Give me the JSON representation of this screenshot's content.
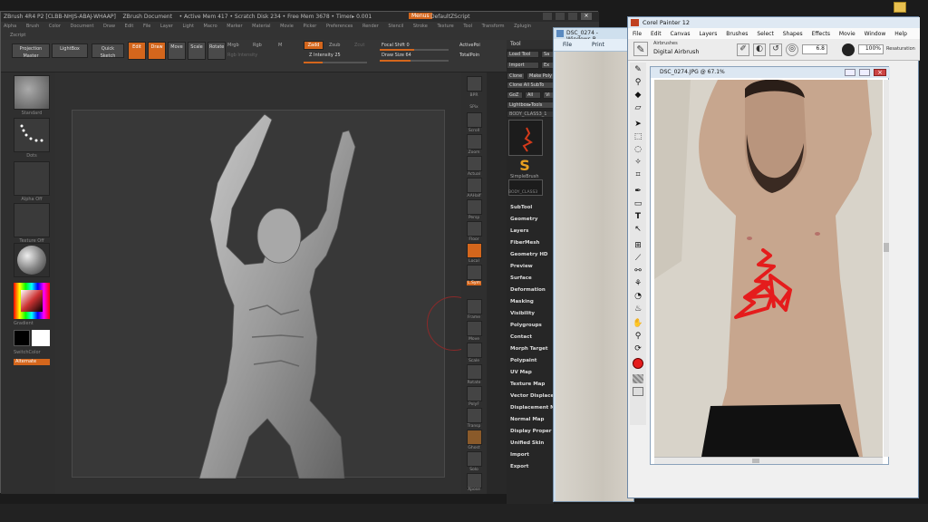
{
  "zbrush": {
    "title_left": "ZBrush 4R4 P2 [CLBB-NHJS-ABAJ-WHAAP]",
    "title_doc": "ZBrush Document",
    "title_status": "• Active Mem 417 • Scratch Disk 234 • Free Mem 3678 • Timer▸ 0.001",
    "memo_label": "Menus",
    "script_label": "DefaultZScript",
    "menu": [
      "Alpha",
      "Brush",
      "Color",
      "Document",
      "Draw",
      "Edit",
      "File",
      "Layer",
      "Light",
      "Macro",
      "Marker",
      "Material",
      "Movie",
      "Picker",
      "Preferences",
      "Render",
      "Stencil",
      "Stroke",
      "Texture",
      "Tool",
      "Transform",
      "Zplugin"
    ],
    "submenu": "Zscript",
    "shelf": {
      "projection_master": "Projection Master",
      "lightbox": "LightBox",
      "quick_sketch": "Quick Sketch",
      "edit": "Edit",
      "draw": "Draw",
      "move": "Move",
      "scale": "Scale",
      "rotate": "Rotate",
      "mrgb": "Mrgb",
      "rgb": "Rgb",
      "m": "M",
      "rgb_intensity": "Rgb Intensity",
      "zadd": "Zadd",
      "zsub": "Zsub",
      "zcut": "Zcut",
      "z_intensity": "Z Intensity 25",
      "focal_shift": "Focal Shift 0",
      "draw_size": "Draw Size 64",
      "active_points": "ActivePoi",
      "total_points": "TotalPoin"
    },
    "left": {
      "standard": "Standard",
      "dots": "Dots",
      "alpha_off": "Alpha Off",
      "texture_off": "Texture Off",
      "gradient": "Gradient",
      "switch_color": "SwitchColor",
      "alternate": "Alternate"
    },
    "right_shelf": [
      "BPR",
      "SPix",
      "Scroll",
      "Zoom",
      "Actual",
      "AAHalf",
      "Persp",
      "Floor",
      "Local",
      "L.Sym",
      "Frame",
      "Move",
      "Scale",
      "Rotate",
      "PolyF",
      "Transp",
      "Ghost",
      "Solo",
      "Xpose"
    ],
    "tool_panel": {
      "header": "Tool",
      "load_tool": "Load Tool",
      "save": "Sa",
      "import": "Import",
      "export": "Ex",
      "clone": "Clone",
      "make_poly": "Make Poly",
      "clone_all": "Clone All SubTo",
      "goz": "GoZ",
      "all": "All",
      "visible": "Vi",
      "lightbox_tools": "Lightbox▸Tools",
      "current_tool": "BODY_CLASS3_1",
      "simple_brush": "SimpleBrush",
      "mini_tool": "BODY_CLASS3",
      "items": [
        "SubTool",
        "Geometry",
        "Layers",
        "FiberMesh",
        "Geometry HD",
        "Preview",
        "Surface",
        "Deformation",
        "Masking",
        "Visibility",
        "Polygroups",
        "Contact",
        "Morph Target",
        "Polypaint",
        "UV Map",
        "Texture Map",
        "Vector Displace",
        "Displacement M",
        "Normal Map",
        "Display Proper",
        "Unified Skin",
        "Import",
        "Export"
      ]
    }
  },
  "photo_viewer": {
    "title": "DSC_0274 - Windows P",
    "file": "File",
    "print": "Print"
  },
  "painter": {
    "title": "Corel Painter 12",
    "menu": [
      "File",
      "Edit",
      "Canvas",
      "Layers",
      "Brushes",
      "Select",
      "Shapes",
      "Effects",
      "Movie",
      "Window",
      "Help"
    ],
    "brush_category": "Airbrushes",
    "brush_variant": "Digital Airbrush",
    "size": "6.8",
    "opacity": "100%",
    "resaturation": "Resaturation",
    "document_title": "DSC_0274.JPG @ 67.1%",
    "toolbox": [
      "brush-icon",
      "dropper-icon",
      "paint-bucket-icon",
      "eraser-icon",
      "layer-adjuster-icon",
      "rectangle-select-icon",
      "lasso-icon",
      "magic-wand-icon",
      "crop-icon",
      "pen-icon",
      "shape-icon",
      "text-icon",
      "shape-select-icon",
      "divine-proportion-icon",
      "perspective-icon",
      "clone-icon",
      "rubber-stamp-icon",
      "dodge-icon",
      "burn-icon",
      "grabber-icon",
      "magnifier-icon",
      "rotate-page-icon",
      "color-swatch-icon",
      "paper-icon",
      "media-icon"
    ]
  },
  "colors": {
    "zbrush_accent": "#d4661c",
    "painter_stroke": "#e51c1c",
    "painter_fg": "#e51c1c"
  }
}
